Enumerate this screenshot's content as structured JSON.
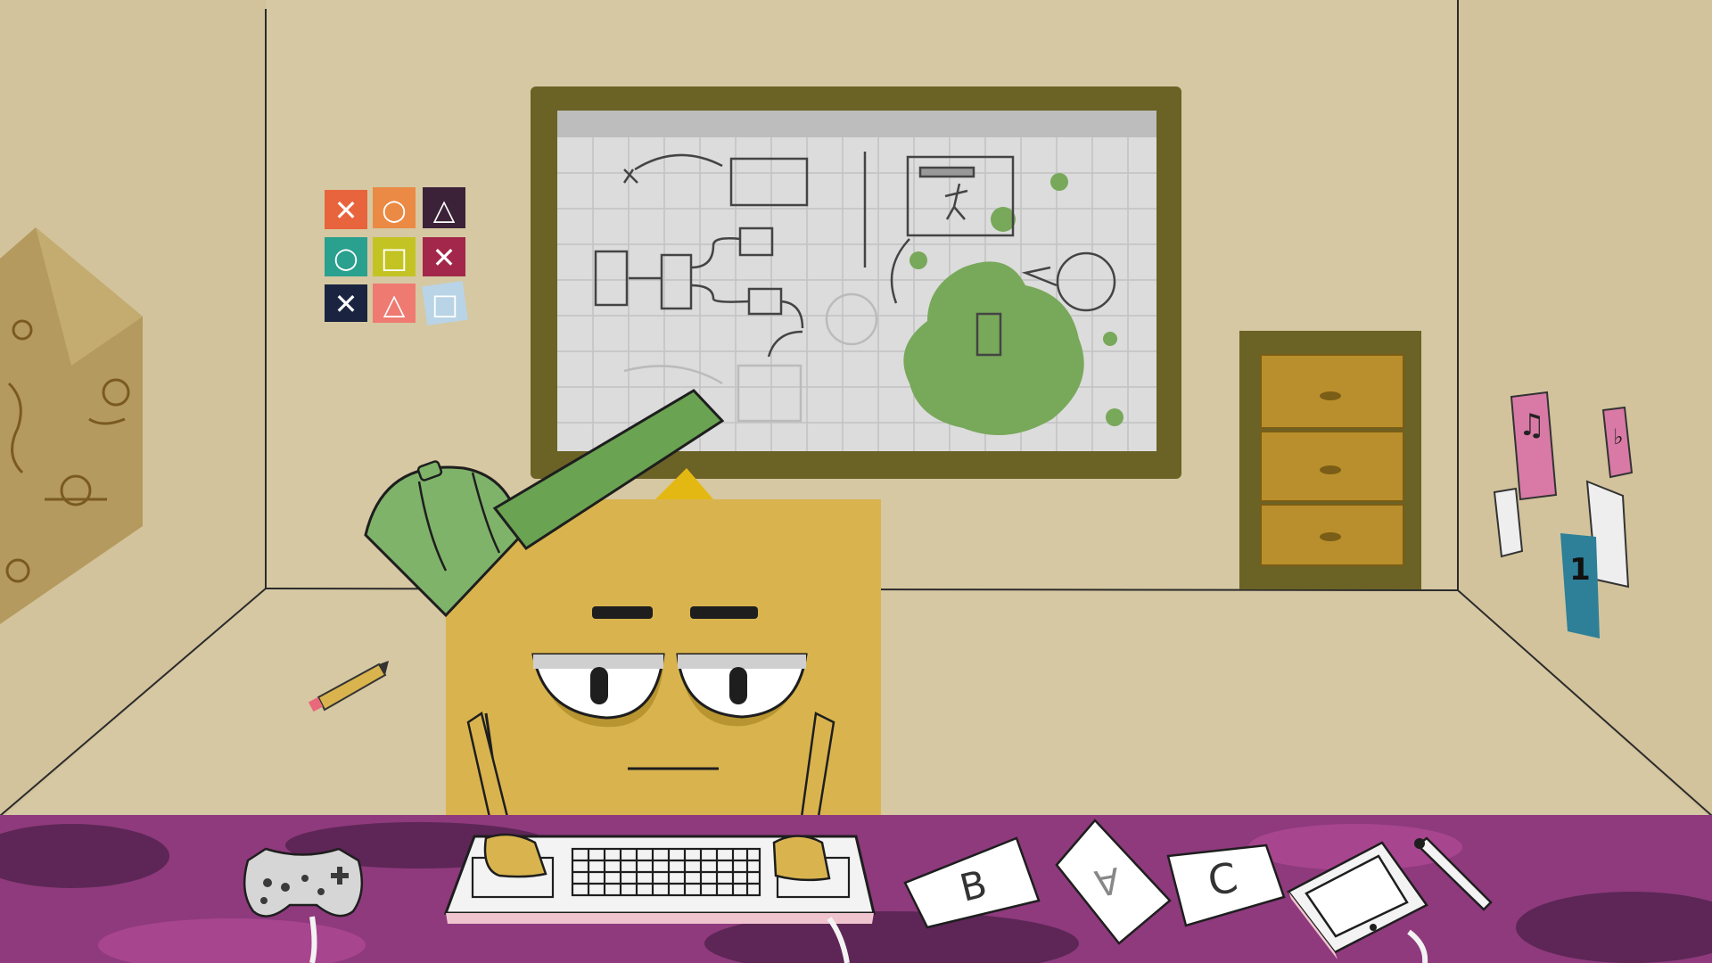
{
  "colors": {
    "wall": "#d6c8a2",
    "frame": "#6b6226",
    "board": "#dcdcdc",
    "slime": "#78a85a",
    "character": "#d9b44e",
    "cap": "#7fb36a",
    "desk": "#8e3a7d",
    "cabinet": "#b88f2c"
  },
  "tiles": {
    "row1": [
      "✕",
      "○",
      "△"
    ],
    "row2": [
      "○",
      "□",
      "✕"
    ],
    "row3": [
      "✕",
      "△",
      "□"
    ]
  },
  "desk_cards": {
    "b": "B",
    "a": "A",
    "c": "C"
  },
  "wall_notes": {
    "music": "♫",
    "flat": "♭",
    "number": "1"
  }
}
